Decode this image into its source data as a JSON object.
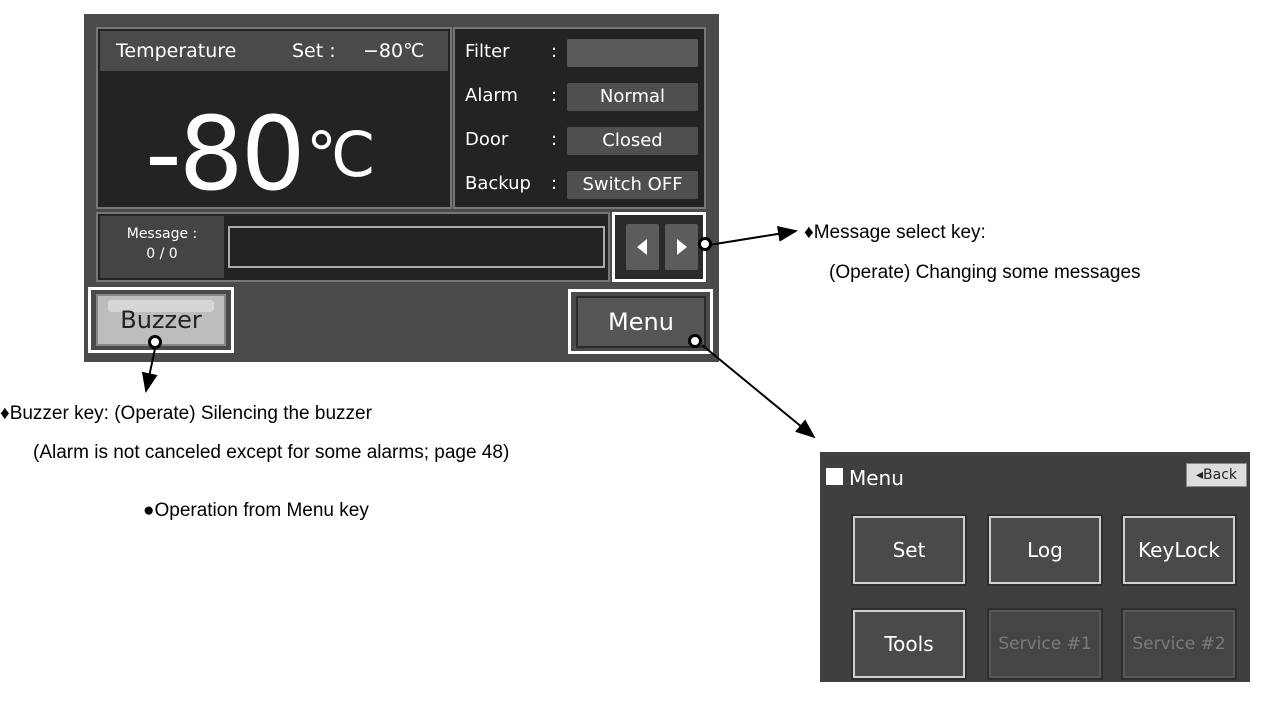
{
  "main": {
    "temp_label": "Temperature",
    "set_label": "Set :",
    "set_value": "−80℃",
    "temp_value": "-80",
    "temp_unit": "℃",
    "status": [
      {
        "label": "Filter",
        "value": ""
      },
      {
        "label": "Alarm",
        "value": "Normal"
      },
      {
        "label": "Door",
        "value": "Closed"
      },
      {
        "label": "Backup",
        "value": "Switch OFF"
      }
    ],
    "colon": ":",
    "message_label": "Message :",
    "message_count": "0 / 0",
    "message_text": "",
    "buzzer_label": "Buzzer",
    "menu_label": "Menu"
  },
  "notes": {
    "message_key_title": "♦Message select key:",
    "message_key_desc": "(Operate) Changing some messages",
    "buzzer_key_line1": "♦Buzzer key: (Operate) Silencing the buzzer",
    "buzzer_key_line2": "(Alarm is not canceled except for some alarms; page 48)",
    "operation_note": "●Operation from Menu key"
  },
  "menu_popup": {
    "title": "Menu",
    "back_label": "◂Back",
    "buttons": [
      {
        "label": "Set",
        "enabled": true
      },
      {
        "label": "Log",
        "enabled": true
      },
      {
        "label": "KeyLock",
        "enabled": true
      },
      {
        "label": "Tools",
        "enabled": true
      },
      {
        "label": "Service #1",
        "enabled": false
      },
      {
        "label": "Service #2",
        "enabled": false
      }
    ]
  },
  "colors": {
    "panel_bg": "#4a4a4a",
    "display_bg": "#232323",
    "highlight_frame": "#ffffff"
  }
}
